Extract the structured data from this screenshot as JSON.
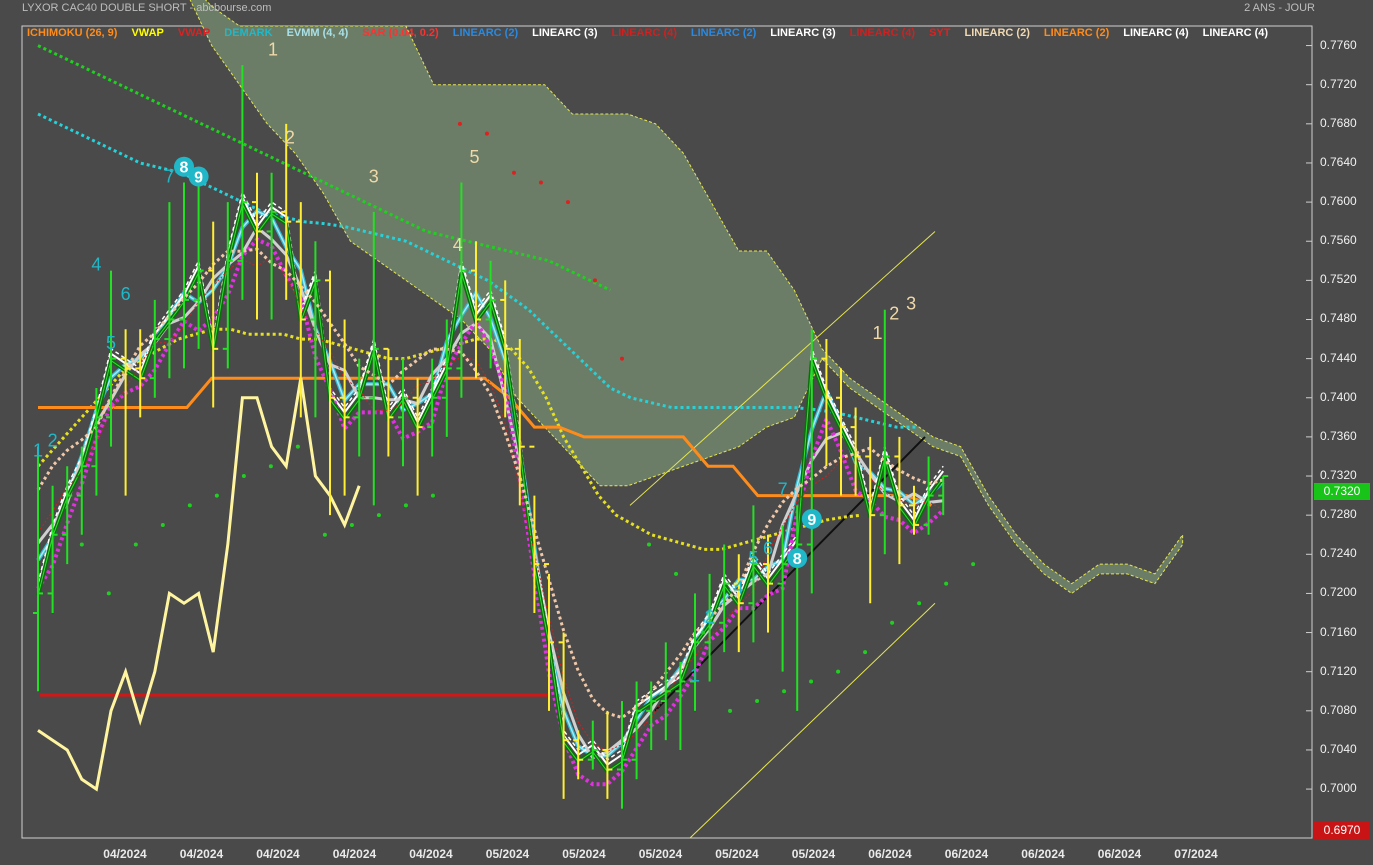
{
  "header": {
    "title": "LYXOR CAC40 DOUBLE SHORT - abcbourse.com",
    "period": "2 ANS - JOUR"
  },
  "legend": [
    {
      "label": "ICHIMOKU (26, 9)",
      "color": "#ff8c1a"
    },
    {
      "label": "VWAP",
      "color": "#ffff00"
    },
    {
      "label": "VWAP",
      "color": "#e02020"
    },
    {
      "label": "DEMARK",
      "color": "#20b8c8"
    },
    {
      "label": "EVMM (4, 4)",
      "color": "#a8e0e8"
    },
    {
      "label": "SAR (0.04, 0.2)",
      "color": "#ff3030"
    },
    {
      "label": "LINEARC (2)",
      "color": "#2a8ae0"
    },
    {
      "label": "LINEARC (3)",
      "color": "#ffffff"
    },
    {
      "label": "LINEARC (4)",
      "color": "#d02020"
    },
    {
      "label": "LINEARC (2)",
      "color": "#2a8ae0"
    },
    {
      "label": "LINEARC (3)",
      "color": "#ffffff"
    },
    {
      "label": "LINEARC (4)",
      "color": "#d02020"
    },
    {
      "label": "SYT",
      "color": "#e02020"
    },
    {
      "label": "LINEARC (2)",
      "color": "#f0d8b0"
    },
    {
      "label": "LINEARC (2)",
      "color": "#ff8c1a"
    },
    {
      "label": "LINEARC (4)",
      "color": "#ffffff"
    },
    {
      "label": "LINEARC (4)",
      "color": "#ffffff"
    }
  ],
  "badges": {
    "last_price": "0.7320",
    "low_price": "0.6970"
  },
  "chart_data": {
    "type": "candlestick",
    "ylim": [
      0.695,
      0.778
    ],
    "y_ticks": [
      "0.7760",
      "0.7720",
      "0.7680",
      "0.7640",
      "0.7600",
      "0.7560",
      "0.7520",
      "0.7480",
      "0.7440",
      "0.7400",
      "0.7360",
      "0.7320",
      "0.7280",
      "0.7240",
      "0.7200",
      "0.7160",
      "0.7120",
      "0.7080",
      "0.7040",
      "0.7000"
    ],
    "x_ticks": [
      "04/2024",
      "04/2024",
      "04/2024",
      "04/2024",
      "04/2024",
      "05/2024",
      "05/2024",
      "05/2024",
      "05/2024",
      "05/2024",
      "06/2024",
      "06/2024",
      "06/2024",
      "06/2024",
      "07/2024"
    ],
    "candles": [
      [
        0.718,
        0.72,
        0.71,
        0.735
      ],
      [
        0.72,
        0.726,
        0.718,
        0.731
      ],
      [
        0.726,
        0.73,
        0.723,
        0.733
      ],
      [
        0.73,
        0.733,
        0.726,
        0.735
      ],
      [
        0.733,
        0.738,
        0.73,
        0.741
      ],
      [
        0.738,
        0.744,
        0.735,
        0.753
      ],
      [
        0.744,
        0.743,
        0.73,
        0.747
      ],
      [
        0.743,
        0.742,
        0.738,
        0.747
      ],
      [
        0.742,
        0.746,
        0.74,
        0.75
      ],
      [
        0.746,
        0.748,
        0.742,
        0.76
      ],
      [
        0.748,
        0.75,
        0.743,
        0.762
      ],
      [
        0.75,
        0.753,
        0.745,
        0.762
      ],
      [
        0.753,
        0.745,
        0.739,
        0.758
      ],
      [
        0.745,
        0.754,
        0.743,
        0.76
      ],
      [
        0.754,
        0.76,
        0.75,
        0.774
      ],
      [
        0.76,
        0.757,
        0.748,
        0.763
      ],
      [
        0.757,
        0.759,
        0.748,
        0.763
      ],
      [
        0.759,
        0.758,
        0.75,
        0.768
      ],
      [
        0.758,
        0.748,
        0.738,
        0.76
      ],
      [
        0.748,
        0.752,
        0.738,
        0.756
      ],
      [
        0.752,
        0.74,
        0.728,
        0.753
      ],
      [
        0.74,
        0.738,
        0.73,
        0.748
      ],
      [
        0.738,
        0.74,
        0.734,
        0.744
      ],
      [
        0.74,
        0.745,
        0.729,
        0.759
      ],
      [
        0.745,
        0.738,
        0.734,
        0.745
      ],
      [
        0.738,
        0.74,
        0.733,
        0.744
      ],
      [
        0.74,
        0.737,
        0.73,
        0.742
      ],
      [
        0.737,
        0.74,
        0.734,
        0.744
      ],
      [
        0.74,
        0.743,
        0.736,
        0.748
      ],
      [
        0.743,
        0.753,
        0.74,
        0.762
      ],
      [
        0.753,
        0.748,
        0.742,
        0.756
      ],
      [
        0.748,
        0.75,
        0.743,
        0.754
      ],
      [
        0.75,
        0.745,
        0.738,
        0.752
      ],
      [
        0.745,
        0.735,
        0.729,
        0.746
      ],
      [
        0.735,
        0.723,
        0.718,
        0.73
      ],
      [
        0.723,
        0.715,
        0.708,
        0.722
      ],
      [
        0.715,
        0.705,
        0.699,
        0.716
      ],
      [
        0.705,
        0.703,
        0.701,
        0.706
      ],
      [
        0.703,
        0.704,
        0.702,
        0.707
      ],
      [
        0.704,
        0.702,
        0.699,
        0.708
      ],
      [
        0.702,
        0.703,
        0.698,
        0.709
      ],
      [
        0.703,
        0.708,
        0.701,
        0.711
      ],
      [
        0.708,
        0.709,
        0.704,
        0.711
      ],
      [
        0.709,
        0.71,
        0.705,
        0.715
      ],
      [
        0.71,
        0.711,
        0.704,
        0.713
      ],
      [
        0.711,
        0.715,
        0.708,
        0.72
      ],
      [
        0.715,
        0.717,
        0.711,
        0.722
      ],
      [
        0.717,
        0.721,
        0.714,
        0.725
      ],
      [
        0.721,
        0.719,
        0.714,
        0.724
      ],
      [
        0.719,
        0.723,
        0.715,
        0.729
      ],
      [
        0.723,
        0.721,
        0.716,
        0.726
      ],
      [
        0.721,
        0.723,
        0.712,
        0.727
      ],
      [
        0.723,
        0.725,
        0.708,
        0.729
      ],
      [
        0.725,
        0.744,
        0.72,
        0.747
      ],
      [
        0.744,
        0.74,
        0.733,
        0.746
      ],
      [
        0.74,
        0.737,
        0.73,
        0.743
      ],
      [
        0.737,
        0.734,
        0.73,
        0.739
      ],
      [
        0.734,
        0.728,
        0.719,
        0.736
      ],
      [
        0.728,
        0.734,
        0.724,
        0.749
      ],
      [
        0.734,
        0.729,
        0.723,
        0.736
      ],
      [
        0.729,
        0.727,
        0.726,
        0.731
      ],
      [
        0.727,
        0.73,
        0.726,
        0.734
      ],
      [
        0.73,
        0.732,
        0.728,
        0.732
      ]
    ],
    "vwap": [
      0.733,
      0.735,
      0.737,
      0.739,
      0.741,
      0.743,
      0.744,
      0.745,
      0.746,
      0.7465,
      0.747,
      0.747,
      0.7465,
      0.7465,
      0.7465,
      0.746,
      0.746,
      0.7455,
      0.745,
      0.7445,
      0.744,
      0.744,
      0.7445,
      0.745,
      0.7455,
      0.746,
      0.746,
      0.745,
      0.743,
      0.74,
      0.736,
      0.733,
      0.73,
      0.728,
      0.727,
      0.726,
      0.7255,
      0.725,
      0.7245,
      0.7245,
      0.725,
      0.7255,
      0.726,
      0.7265,
      0.727,
      0.7275,
      0.7278,
      0.728
    ],
    "ma_cyan": [
      0.769,
      0.768,
      0.767,
      0.766,
      0.765,
      0.764,
      0.7635,
      0.763,
      0.762,
      0.761,
      0.76,
      0.759,
      0.7585,
      0.758,
      0.7578,
      0.7575,
      0.757,
      0.7565,
      0.756,
      0.755,
      0.754,
      0.753,
      0.752,
      0.7505,
      0.749,
      0.747,
      0.745,
      0.743,
      0.741,
      0.74,
      0.7395,
      0.739,
      0.739,
      0.739,
      0.739,
      0.739,
      0.739,
      0.739,
      0.7388,
      0.7385,
      0.738,
      0.7375,
      0.737,
      0.737
    ],
    "ma_green": [
      0.776,
      0.775,
      0.774,
      0.773,
      0.772,
      0.771,
      0.77,
      0.769,
      0.768,
      0.767,
      0.766,
      0.765,
      0.764,
      0.763,
      0.762,
      0.761,
      0.76,
      0.759,
      0.758,
      0.757,
      0.7565,
      0.756,
      0.7555,
      0.755,
      0.7545,
      0.754,
      0.753,
      0.752,
      0.751
    ],
    "ichimoku_upper": [
      0.783,
      0.776,
      0.772,
      0.768,
      0.765,
      0.761,
      0.756,
      0.754,
      0.752,
      0.75,
      0.748,
      0.745,
      0.74,
      0.737,
      0.734,
      0.731,
      0.731,
      0.732,
      0.733,
      0.734,
      0.735,
      0.737,
      0.738,
      0.744,
      0.747,
      0.748,
      0.748,
      0.748,
      0.747,
      0.746,
      0.745,
      0.744,
      0.743,
      0.743,
      0.741,
      0.738,
      0.736,
      0.736,
      0.735,
      0.735,
      0.735,
      0.735,
      0.735
    ],
    "ichimoku_lower": [
      0.783,
      0.78,
      0.778,
      0.778,
      0.778,
      0.778,
      0.778,
      0.778,
      0.778,
      0.772,
      0.772,
      0.772,
      0.772,
      0.772,
      0.769,
      0.769,
      0.769,
      0.768,
      0.765,
      0.76,
      0.755,
      0.755,
      0.751,
      0.745,
      0.742,
      0.74,
      0.738,
      0.736,
      0.735,
      0.73,
      0.726,
      0.723,
      0.721,
      0.723,
      0.723,
      0.722,
      0.726
    ],
    "kijun": [
      0.739,
      0.739,
      0.739,
      0.739,
      0.739,
      0.739,
      0.739,
      0.742,
      0.742,
      0.742,
      0.742,
      0.742,
      0.742,
      0.742,
      0.742,
      0.742,
      0.742,
      0.742,
      0.742,
      0.74,
      0.737,
      0.737,
      0.736,
      0.736,
      0.736,
      0.736,
      0.736,
      0.733,
      0.733,
      0.73,
      0.73,
      0.73,
      0.73,
      0.73,
      0.73,
      0.73,
      0.729
    ],
    "chikou": [
      0.706,
      0.705,
      0.704,
      0.701,
      0.7,
      0.708,
      0.712,
      0.707,
      0.712,
      0.72,
      0.719,
      0.72,
      0.714,
      0.725,
      0.74,
      0.74,
      0.735,
      0.733,
      0.742,
      0.732,
      0.73,
      0.727,
      0.731
    ],
    "sar": [
      0.725,
      0.72,
      0.725,
      0.727,
      0.729,
      0.73,
      0.732,
      0.733,
      0.735,
      0.726,
      0.727,
      0.728,
      0.729,
      0.73,
      0.768,
      0.767,
      0.763,
      0.762,
      0.76,
      0.752,
      0.744,
      0.725,
      0.722,
      0.716,
      0.708,
      0.709,
      0.71,
      0.711,
      0.712,
      0.714,
      0.717,
      0.719,
      0.721,
      0.723
    ],
    "counts_up": [
      {
        "label": "1",
        "x": 14,
        "y": 0.775
      },
      {
        "label": "2",
        "x": 15,
        "y": 0.766
      },
      {
        "label": "3",
        "x": 20,
        "y": 0.762
      },
      {
        "label": "4",
        "x": 25,
        "y": 0.755
      },
      {
        "label": "5",
        "x": 26,
        "y": 0.764
      },
      {
        "label": "1",
        "x": 50,
        "y": 0.746
      },
      {
        "label": "2",
        "x": 51,
        "y": 0.748
      },
      {
        "label": "3",
        "x": 52,
        "y": 0.749
      }
    ],
    "counts_down": [
      {
        "label": "1",
        "x": 0,
        "y": 0.734
      },
      {
        "label": "2",
        "x": 1,
        "y": 0.735
      },
      {
        "label": "4",
        "x": 4,
        "y": 0.753
      },
      {
        "label": "5",
        "x": 5,
        "y": 0.745
      },
      {
        "label": "6",
        "x": 6,
        "y": 0.75
      },
      {
        "label": "7",
        "x": 9,
        "y": 0.762
      },
      {
        "label": "8",
        "x": 10,
        "y": 0.763
      },
      {
        "label": "9",
        "x": 11,
        "y": 0.762
      },
      {
        "label": "1",
        "x": 41,
        "y": 0.711
      },
      {
        "label": "2",
        "x": 42,
        "y": 0.717
      },
      {
        "label": "4",
        "x": 44,
        "y": 0.72
      },
      {
        "label": "5",
        "x": 45,
        "y": 0.723
      },
      {
        "label": "6",
        "x": 46,
        "y": 0.724
      },
      {
        "label": "7",
        "x": 47,
        "y": 0.73
      },
      {
        "label": "8",
        "x": 48,
        "y": 0.723
      },
      {
        "label": "9",
        "x": 49,
        "y": 0.727
      }
    ]
  }
}
